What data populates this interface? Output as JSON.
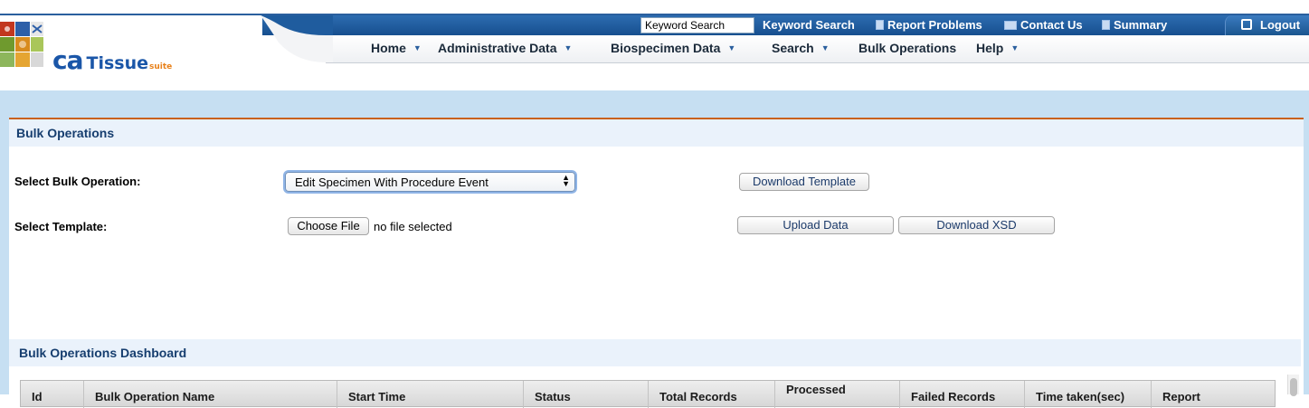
{
  "header": {
    "logo": {
      "ca": "ca",
      "tissue": "Tissue",
      "suite": "suite"
    },
    "keyword_search_value": "Keyword Search",
    "links": {
      "keyword_search": "Keyword Search",
      "report_problems": "Report Problems",
      "contact_us": "Contact Us",
      "summary": "Summary",
      "logout": "Logout"
    },
    "icons": {
      "report_problems": "document-icon",
      "contact_us": "envelope-icon",
      "summary": "document-icon",
      "logout": "logout-icon"
    },
    "menu": [
      {
        "label": "Home",
        "dropdown": true
      },
      {
        "label": "Administrative Data",
        "dropdown": true
      },
      {
        "label": "Biospecimen Data",
        "dropdown": true
      },
      {
        "label": "Search",
        "dropdown": true
      },
      {
        "label": "Bulk Operations",
        "dropdown": false
      },
      {
        "label": "Help",
        "dropdown": true
      }
    ],
    "colors": {
      "top_bar": "#1f5c9e",
      "accent_line": "#c9611c",
      "band": "#c6dff2"
    }
  },
  "bulk": {
    "title": "Bulk Operations",
    "select_operation_label": "Select Bulk Operation:",
    "selected_operation": "Edit Specimen With Procedure Event",
    "download_template_button": "Download Template",
    "select_template_label": "Select Template:",
    "choose_file_button": "Choose File",
    "file_status": "no file selected",
    "upload_data_button": "Upload Data",
    "download_xsd_button": "Download XSD"
  },
  "dashboard": {
    "title": "Bulk Operations Dashboard",
    "columns": [
      "Id",
      "Bulk Operation Name",
      "Start Time",
      "Status",
      "Total Records",
      "Processed",
      "Failed Records",
      "Time taken(sec)",
      "Report"
    ]
  }
}
